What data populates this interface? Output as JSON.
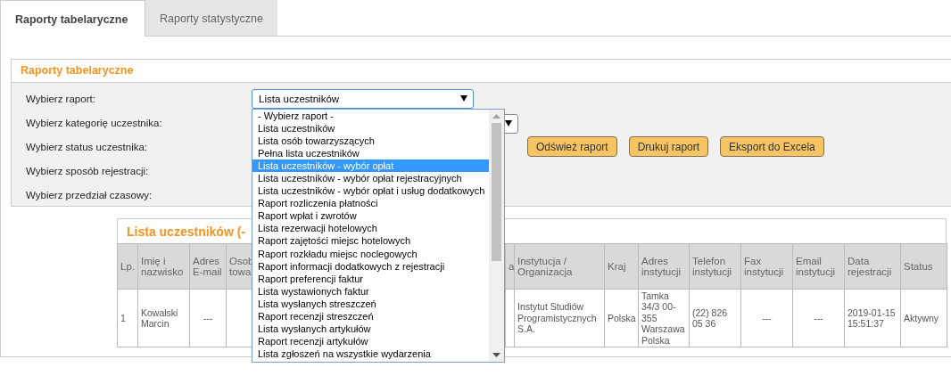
{
  "tabs": [
    {
      "label": "Raporty tabelaryczne",
      "selected": true
    },
    {
      "label": "Raporty statystyczne",
      "selected": false
    }
  ],
  "panel": {
    "title": "Raporty tabelaryczne",
    "fields": [
      {
        "label": "Wybierz raport:",
        "kind": "select",
        "value": "Lista uczestników",
        "expanded": true
      },
      {
        "label": "Wybierz kategorię uczestnika:",
        "kind": "covered_select"
      },
      {
        "label": "Wybierz status uczestnika:",
        "kind": "buttons"
      },
      {
        "label": "Wybierz sposób rejestracji:",
        "kind": "plain"
      },
      {
        "label": "Wybierz przedział czasowy:",
        "kind": "plain"
      }
    ],
    "buttons": [
      "Odśwież raport",
      "Drukuj raport",
      "Eksport do Excela"
    ],
    "dropdown": [
      {
        "label": "- Wybierz raport -",
        "selected": false
      },
      {
        "label": "Lista uczestników",
        "selected": false
      },
      {
        "label": "Lista osób towarzyszących",
        "selected": false
      },
      {
        "label": "Pełna lista uczestników",
        "selected": false
      },
      {
        "label": "Lista uczestników - wybór opłat",
        "selected": true
      },
      {
        "label": "Lista uczestników - wybór opłat rejestracyjnych",
        "selected": false
      },
      {
        "label": "Lista uczestników - wybór opłat i usług dodatkowych",
        "selected": false
      },
      {
        "label": "Raport rozliczenia płatności",
        "selected": false
      },
      {
        "label": "Raport wpłat i zwrotów",
        "selected": false
      },
      {
        "label": "Lista rezerwacji hotelowych",
        "selected": false
      },
      {
        "label": "Raport zajętości miejsc hotelowych",
        "selected": false
      },
      {
        "label": "Raport rozkładu miejsc noclegowych",
        "selected": false
      },
      {
        "label": "Raport informacji dodatkowych z rejestracji",
        "selected": false
      },
      {
        "label": "Raport preferencji faktur",
        "selected": false
      },
      {
        "label": "Lista wystawionych faktur",
        "selected": false
      },
      {
        "label": "Lista wysłanych streszczeń",
        "selected": false
      },
      {
        "label": "Raport recenzji streszczeń",
        "selected": false
      },
      {
        "label": "Lista wysłanych artykułów",
        "selected": false
      },
      {
        "label": "Raport recenzji artykułów",
        "selected": false
      },
      {
        "label": "Lista zgłoszeń na wszystkie wydarzenia",
        "selected": false
      }
    ]
  },
  "table": {
    "title": "Lista uczestników (-",
    "columns": [
      {
        "label": "Lp.",
        "kind": "text"
      },
      {
        "label": "Imię i nazwisko",
        "kind": "text"
      },
      {
        "label": "Adres E-mail",
        "kind": "centered"
      },
      {
        "label": "Osob towa",
        "kind": "partial"
      },
      {
        "kind": "covered"
      },
      {
        "label": "a",
        "kind": "partial"
      },
      {
        "label": "Instytucja / Organizacja",
        "kind": "text"
      },
      {
        "label": "Kraj",
        "kind": "text"
      },
      {
        "label": "Adres instytucji",
        "kind": "text"
      },
      {
        "label": "Telefon instytucji",
        "kind": "text"
      },
      {
        "label": "Fax instytucji",
        "kind": "centered"
      },
      {
        "label": "Email instytucji",
        "kind": "centered"
      },
      {
        "label": "Data rejestracji",
        "kind": "text"
      },
      {
        "label": "Status",
        "kind": "text"
      }
    ],
    "rows": [
      [
        "1",
        "Kowalski Marcin",
        "---",
        "",
        "",
        "",
        "Instytut Studiów Programistycznych S.A.",
        "Polska",
        "Tamka 34/3 00-355 Warszawa Polska",
        "(22) 826 05 36",
        "---",
        "---",
        "2019-01-15 15:51:37",
        "Aktywny"
      ]
    ]
  }
}
